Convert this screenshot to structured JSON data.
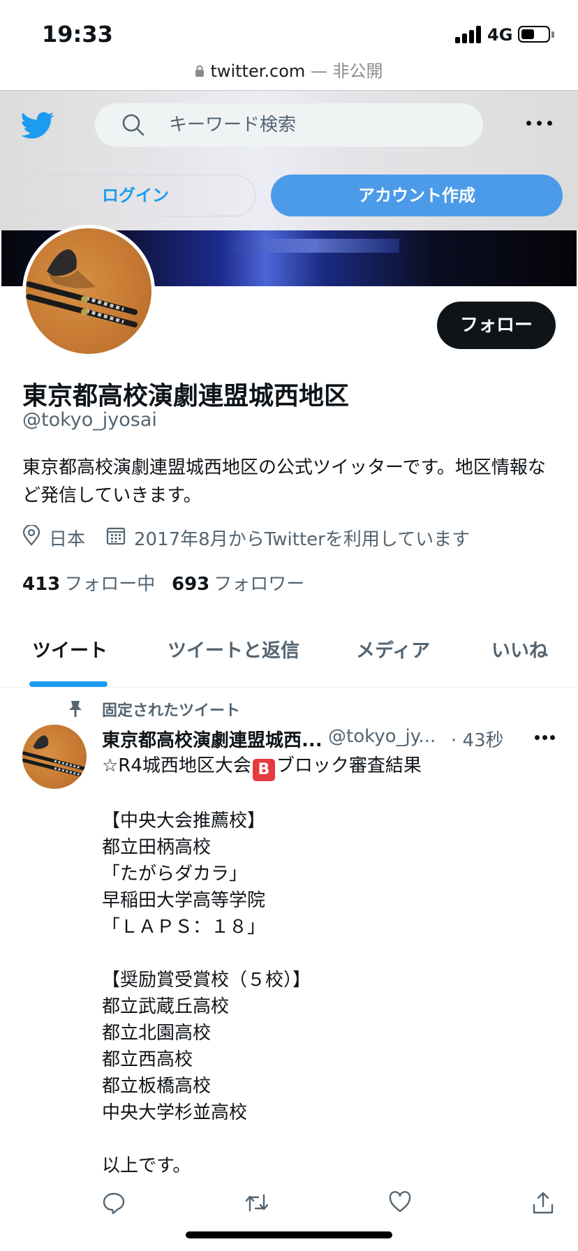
{
  "status_bar": {
    "time": "19:33",
    "network": "4G"
  },
  "browser": {
    "host": "twitter.com",
    "privacy": " — 非公開"
  },
  "header": {
    "search_placeholder": "キーワード検索",
    "login_label": "ログイン",
    "signup_label": "アカウント作成"
  },
  "profile": {
    "follow_label": "フォロー",
    "name": "東京都高校演劇連盟城西地区",
    "handle": "@tokyo_jyosai",
    "bio": "東京都高校演劇連盟城西地区の公式ツイッターです。地区情報など発信していきます。",
    "location": "日本",
    "joined": "2017年8月からTwitterを利用しています",
    "following_count": "413",
    "following_label": "フォロー中",
    "followers_count": "693",
    "followers_label": "フォロワー"
  },
  "tabs": [
    {
      "label": "ツイート",
      "active": true
    },
    {
      "label": "ツイートと返信",
      "active": false
    },
    {
      "label": "メディア",
      "active": false
    },
    {
      "label": "いいね",
      "active": false
    }
  ],
  "pinned_tweet": {
    "pinned_label": "固定されたツイート",
    "author_name": "東京都高校演劇連盟城西...",
    "author_handle": "@tokyo_jy...",
    "time": "· 43秒",
    "text_prefix": "☆R4城西地区大会",
    "emoji_letter": "B",
    "text_suffix": "ブロック審査結果",
    "body": "【中央大会推薦校】\n都立田柄高校\n「たがらダカラ」\n早稲田大学高等学院\n「ＬＡＰＳ：１８」\n\n【奨励賞受賞校（５校）】\n都立武蔵丘高校\n都立北園高校\n都立西高校\n都立板橋高校\n中央大学杉並高校\n\n以上です。"
  },
  "colors": {
    "twitter_blue": "#1d9bf0",
    "signup_button": "#4c9be8",
    "follow_button": "#0f1419",
    "secondary_text": "#536471"
  },
  "icons": [
    "twitter-bird-icon",
    "search-icon",
    "more-icon",
    "location-icon",
    "calendar-icon",
    "pin-icon",
    "reply-icon",
    "retweet-icon",
    "like-icon",
    "share-icon",
    "lock-icon"
  ]
}
